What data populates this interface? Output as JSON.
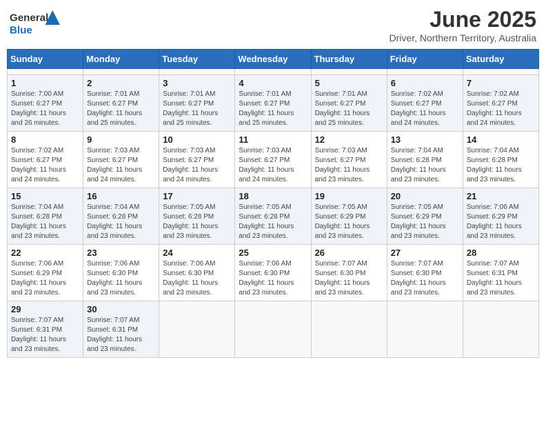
{
  "header": {
    "logo_general": "General",
    "logo_blue": "Blue",
    "month_year": "June 2025",
    "location": "Driver, Northern Territory, Australia"
  },
  "calendar": {
    "days_of_week": [
      "Sunday",
      "Monday",
      "Tuesday",
      "Wednesday",
      "Thursday",
      "Friday",
      "Saturday"
    ],
    "weeks": [
      [
        {
          "day": null
        },
        {
          "day": null
        },
        {
          "day": null
        },
        {
          "day": null
        },
        {
          "day": null
        },
        {
          "day": null
        },
        {
          "day": null
        }
      ],
      [
        {
          "day": "1",
          "sunrise": "Sunrise: 7:00 AM",
          "sunset": "Sunset: 6:27 PM",
          "daylight": "Daylight: 11 hours and 26 minutes."
        },
        {
          "day": "2",
          "sunrise": "Sunrise: 7:01 AM",
          "sunset": "Sunset: 6:27 PM",
          "daylight": "Daylight: 11 hours and 25 minutes."
        },
        {
          "day": "3",
          "sunrise": "Sunrise: 7:01 AM",
          "sunset": "Sunset: 6:27 PM",
          "daylight": "Daylight: 11 hours and 25 minutes."
        },
        {
          "day": "4",
          "sunrise": "Sunrise: 7:01 AM",
          "sunset": "Sunset: 6:27 PM",
          "daylight": "Daylight: 11 hours and 25 minutes."
        },
        {
          "day": "5",
          "sunrise": "Sunrise: 7:01 AM",
          "sunset": "Sunset: 6:27 PM",
          "daylight": "Daylight: 11 hours and 25 minutes."
        },
        {
          "day": "6",
          "sunrise": "Sunrise: 7:02 AM",
          "sunset": "Sunset: 6:27 PM",
          "daylight": "Daylight: 11 hours and 24 minutes."
        },
        {
          "day": "7",
          "sunrise": "Sunrise: 7:02 AM",
          "sunset": "Sunset: 6:27 PM",
          "daylight": "Daylight: 11 hours and 24 minutes."
        }
      ],
      [
        {
          "day": "8",
          "sunrise": "Sunrise: 7:02 AM",
          "sunset": "Sunset: 6:27 PM",
          "daylight": "Daylight: 11 hours and 24 minutes."
        },
        {
          "day": "9",
          "sunrise": "Sunrise: 7:03 AM",
          "sunset": "Sunset: 6:27 PM",
          "daylight": "Daylight: 11 hours and 24 minutes."
        },
        {
          "day": "10",
          "sunrise": "Sunrise: 7:03 AM",
          "sunset": "Sunset: 6:27 PM",
          "daylight": "Daylight: 11 hours and 24 minutes."
        },
        {
          "day": "11",
          "sunrise": "Sunrise: 7:03 AM",
          "sunset": "Sunset: 6:27 PM",
          "daylight": "Daylight: 11 hours and 24 minutes."
        },
        {
          "day": "12",
          "sunrise": "Sunrise: 7:03 AM",
          "sunset": "Sunset: 6:27 PM",
          "daylight": "Daylight: 11 hours and 23 minutes."
        },
        {
          "day": "13",
          "sunrise": "Sunrise: 7:04 AM",
          "sunset": "Sunset: 6:28 PM",
          "daylight": "Daylight: 11 hours and 23 minutes."
        },
        {
          "day": "14",
          "sunrise": "Sunrise: 7:04 AM",
          "sunset": "Sunset: 6:28 PM",
          "daylight": "Daylight: 11 hours and 23 minutes."
        }
      ],
      [
        {
          "day": "15",
          "sunrise": "Sunrise: 7:04 AM",
          "sunset": "Sunset: 6:28 PM",
          "daylight": "Daylight: 11 hours and 23 minutes."
        },
        {
          "day": "16",
          "sunrise": "Sunrise: 7:04 AM",
          "sunset": "Sunset: 6:28 PM",
          "daylight": "Daylight: 11 hours and 23 minutes."
        },
        {
          "day": "17",
          "sunrise": "Sunrise: 7:05 AM",
          "sunset": "Sunset: 6:28 PM",
          "daylight": "Daylight: 11 hours and 23 minutes."
        },
        {
          "day": "18",
          "sunrise": "Sunrise: 7:05 AM",
          "sunset": "Sunset: 6:28 PM",
          "daylight": "Daylight: 11 hours and 23 minutes."
        },
        {
          "day": "19",
          "sunrise": "Sunrise: 7:05 AM",
          "sunset": "Sunset: 6:29 PM",
          "daylight": "Daylight: 11 hours and 23 minutes."
        },
        {
          "day": "20",
          "sunrise": "Sunrise: 7:05 AM",
          "sunset": "Sunset: 6:29 PM",
          "daylight": "Daylight: 11 hours and 23 minutes."
        },
        {
          "day": "21",
          "sunrise": "Sunrise: 7:06 AM",
          "sunset": "Sunset: 6:29 PM",
          "daylight": "Daylight: 11 hours and 23 minutes."
        }
      ],
      [
        {
          "day": "22",
          "sunrise": "Sunrise: 7:06 AM",
          "sunset": "Sunset: 6:29 PM",
          "daylight": "Daylight: 11 hours and 23 minutes."
        },
        {
          "day": "23",
          "sunrise": "Sunrise: 7:06 AM",
          "sunset": "Sunset: 6:30 PM",
          "daylight": "Daylight: 11 hours and 23 minutes."
        },
        {
          "day": "24",
          "sunrise": "Sunrise: 7:06 AM",
          "sunset": "Sunset: 6:30 PM",
          "daylight": "Daylight: 11 hours and 23 minutes."
        },
        {
          "day": "25",
          "sunrise": "Sunrise: 7:06 AM",
          "sunset": "Sunset: 6:30 PM",
          "daylight": "Daylight: 11 hours and 23 minutes."
        },
        {
          "day": "26",
          "sunrise": "Sunrise: 7:07 AM",
          "sunset": "Sunset: 6:30 PM",
          "daylight": "Daylight: 11 hours and 23 minutes."
        },
        {
          "day": "27",
          "sunrise": "Sunrise: 7:07 AM",
          "sunset": "Sunset: 6:30 PM",
          "daylight": "Daylight: 11 hours and 23 minutes."
        },
        {
          "day": "28",
          "sunrise": "Sunrise: 7:07 AM",
          "sunset": "Sunset: 6:31 PM",
          "daylight": "Daylight: 11 hours and 23 minutes."
        }
      ],
      [
        {
          "day": "29",
          "sunrise": "Sunrise: 7:07 AM",
          "sunset": "Sunset: 6:31 PM",
          "daylight": "Daylight: 11 hours and 23 minutes."
        },
        {
          "day": "30",
          "sunrise": "Sunrise: 7:07 AM",
          "sunset": "Sunset: 6:31 PM",
          "daylight": "Daylight: 11 hours and 23 minutes."
        },
        {
          "day": null
        },
        {
          "day": null
        },
        {
          "day": null
        },
        {
          "day": null
        },
        {
          "day": null
        }
      ]
    ]
  }
}
